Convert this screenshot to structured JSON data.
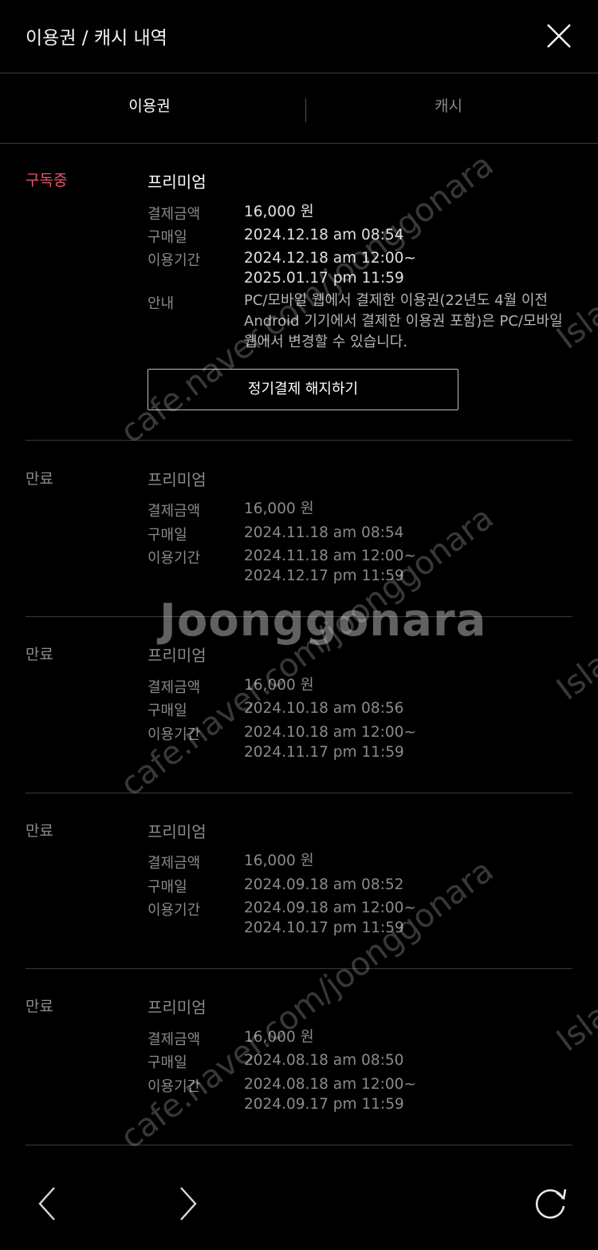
{
  "header": {
    "title": "이용권 / 캐시 내역"
  },
  "tabs": [
    {
      "label": "이용권"
    },
    {
      "label": "캐시"
    }
  ],
  "labels": {
    "amount": "결제금액",
    "purchase_date": "구매일",
    "period": "이용기간",
    "notice": "안내"
  },
  "entries": [
    {
      "status": "구독중",
      "plan": "프리미엄",
      "amount": "16,000 원",
      "purchase_date": "2024.12.18 am 08:54",
      "period_start": "2024.12.18 am 12:00~",
      "period_end": "2025.01.17 pm 11:59",
      "notice": "PC/모바일 웹에서 결제한 이용권(22년도 4월 이전 Android 기기에서 결제한 이용권 포함)은 PC/모바일 웹에서 변경할 수 있습니다.",
      "cancel_button": "정기결제 해지하기"
    },
    {
      "status": "만료",
      "plan": "프리미엄",
      "amount": "16,000 원",
      "purchase_date": "2024.11.18 am 08:54",
      "period_start": "2024.11.18 am 12:00~",
      "period_end": "2024.12.17 pm 11:59"
    },
    {
      "status": "만료",
      "plan": "프리미엄",
      "amount": "16,000 원",
      "purchase_date": "2024.10.18 am 08:56",
      "period_start": "2024.10.18 am 12:00~",
      "period_end": "2024.11.17 pm 11:59"
    },
    {
      "status": "만료",
      "plan": "프리미엄",
      "amount": "16,000 원",
      "purchase_date": "2024.09.18 am 08:52",
      "period_start": "2024.09.18 am 12:00~",
      "period_end": "2024.10.17 pm 11:59"
    },
    {
      "status": "만료",
      "plan": "프리미엄",
      "amount": "16,000 원",
      "purchase_date": "2024.08.18 am 08:50",
      "period_start": "2024.08.18 am 12:00~",
      "period_end": "2024.09.17 pm 11:59"
    }
  ],
  "watermarks": {
    "cafe": "cafe.naver.com/joonggonara",
    "logo": "Joonggonara",
    "island": "Island"
  },
  "icons": {
    "close": "close-icon",
    "back": "chevron-left-icon",
    "forward": "chevron-right-icon",
    "refresh": "refresh-icon"
  },
  "colors": {
    "background": "#000000",
    "active_status": "#e8556a",
    "muted_text": "#8a8a8a",
    "divider": "#3a3a3a"
  }
}
